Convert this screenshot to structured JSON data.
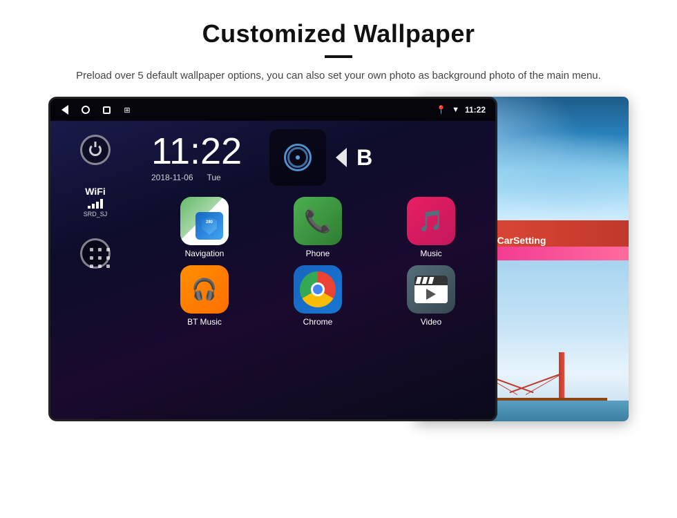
{
  "page": {
    "title": "Customized Wallpaper",
    "subtitle": "Preload over 5 default wallpaper options, you can also set your own photo as background photo of the main menu."
  },
  "device": {
    "time": "11:22",
    "date": "2018-11-06",
    "day": "Tue",
    "wifi_label": "WiFi",
    "wifi_ssid": "SRD_SJ",
    "status_time": "11:22"
  },
  "apps": [
    {
      "name": "Navigation",
      "id": "navigation"
    },
    {
      "name": "Phone",
      "id": "phone"
    },
    {
      "name": "Music",
      "id": "music"
    },
    {
      "name": "BT Music",
      "id": "bt-music"
    },
    {
      "name": "Chrome",
      "id": "chrome"
    },
    {
      "name": "Video",
      "id": "video"
    }
  ],
  "wallpaper": {
    "car_setting_label": "CarSetting"
  },
  "icons": {
    "back": "◁",
    "home": "○",
    "recents": "□",
    "screenshot": "⊞",
    "location": "📍",
    "wifi_status": "▲",
    "b_letter": "B"
  }
}
